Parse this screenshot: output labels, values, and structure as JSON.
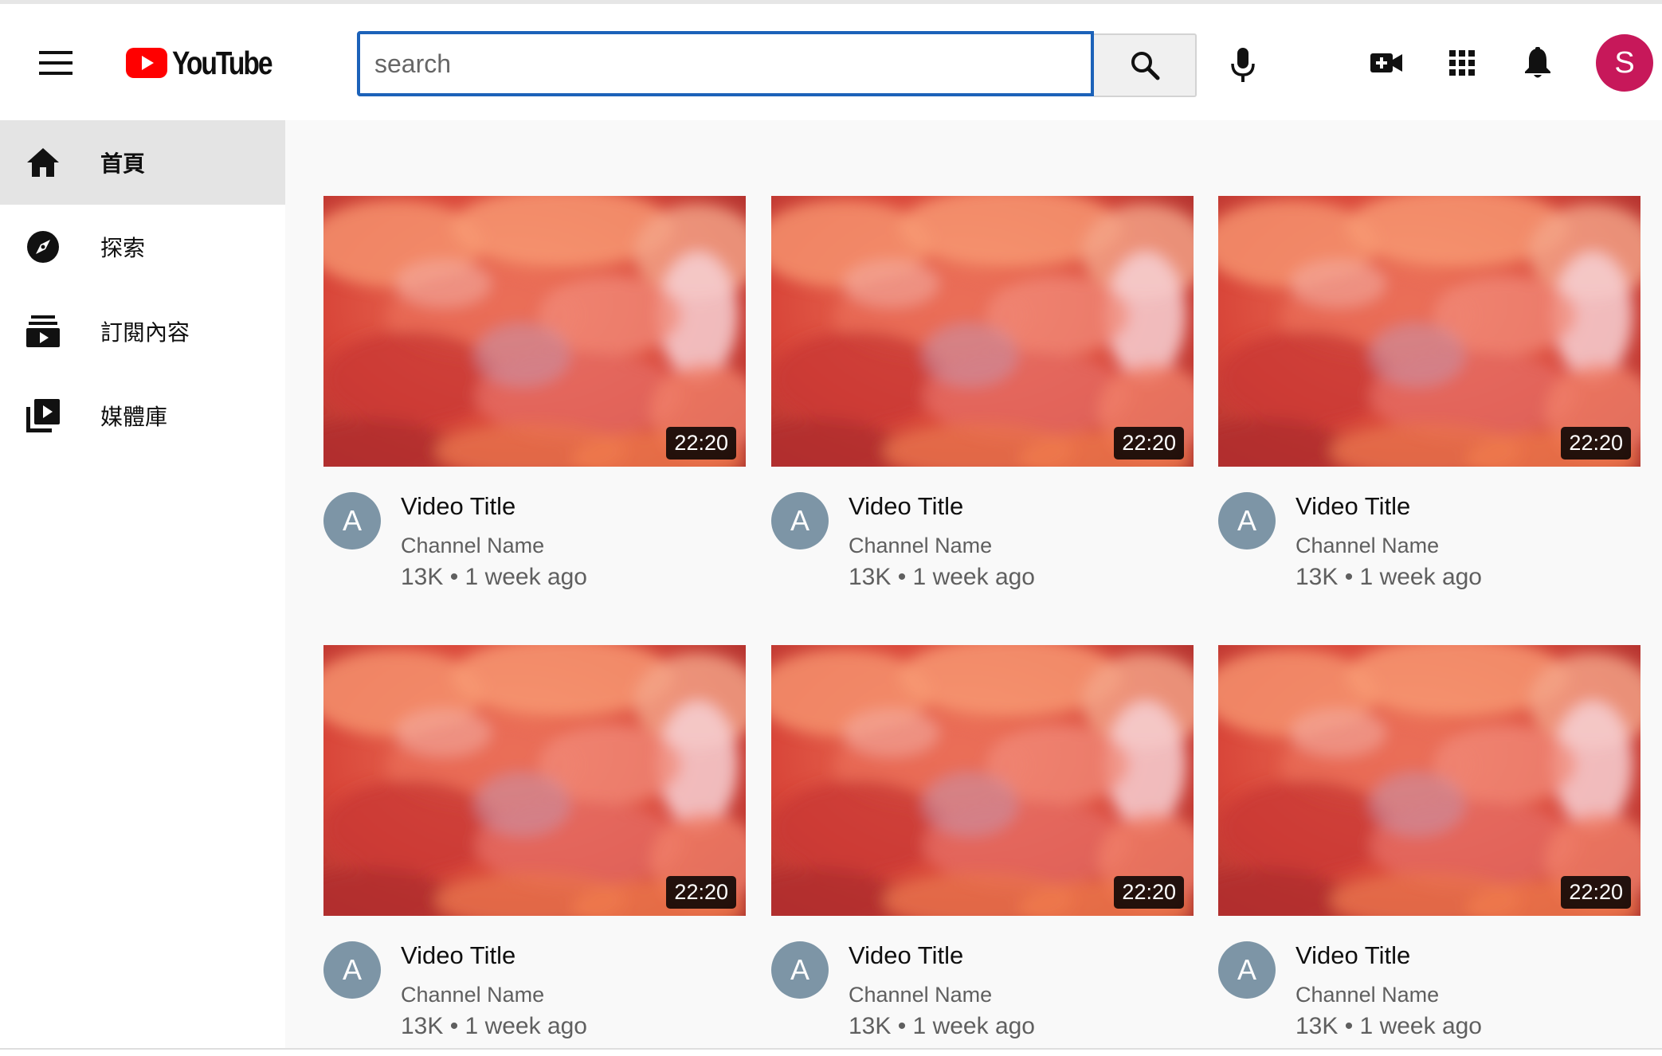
{
  "header": {
    "logo_text": "YouTube",
    "search": {
      "placeholder": "search",
      "value": ""
    },
    "icons": [
      "menu-icon",
      "search-icon",
      "mic-icon",
      "create-video-icon",
      "apps-icon",
      "notifications-icon"
    ],
    "avatar_initial": "S",
    "avatar_color": "#c7185a",
    "accent": "#1c62b9",
    "brand_red": "#ff0000"
  },
  "sidebar": {
    "items": [
      {
        "label": "首頁",
        "icon": "home-icon",
        "active": true
      },
      {
        "label": "探索",
        "icon": "explore-icon",
        "active": false
      },
      {
        "label": "訂閱內容",
        "icon": "subscriptions-icon",
        "active": false
      },
      {
        "label": "媒體庫",
        "icon": "library-icon",
        "active": false
      }
    ]
  },
  "videos": [
    {
      "title": "Video Title",
      "channel": "Channel Name",
      "stats": "13K • 1 week ago",
      "duration": "22:20",
      "avatar": "A"
    },
    {
      "title": "Video Title",
      "channel": "Channel Name",
      "stats": "13K • 1 week ago",
      "duration": "22:20",
      "avatar": "A"
    },
    {
      "title": "Video Title",
      "channel": "Channel Name",
      "stats": "13K • 1 week ago",
      "duration": "22:20",
      "avatar": "A"
    },
    {
      "title": "Video Title",
      "channel": "Channel Name",
      "stats": "13K • 1 week ago",
      "duration": "22:20",
      "avatar": "A"
    },
    {
      "title": "Video Title",
      "channel": "Channel Name",
      "stats": "13K • 1 week ago",
      "duration": "22:20",
      "avatar": "A"
    },
    {
      "title": "Video Title",
      "channel": "Channel Name",
      "stats": "13K • 1 week ago",
      "duration": "22:20",
      "avatar": "A"
    }
  ]
}
